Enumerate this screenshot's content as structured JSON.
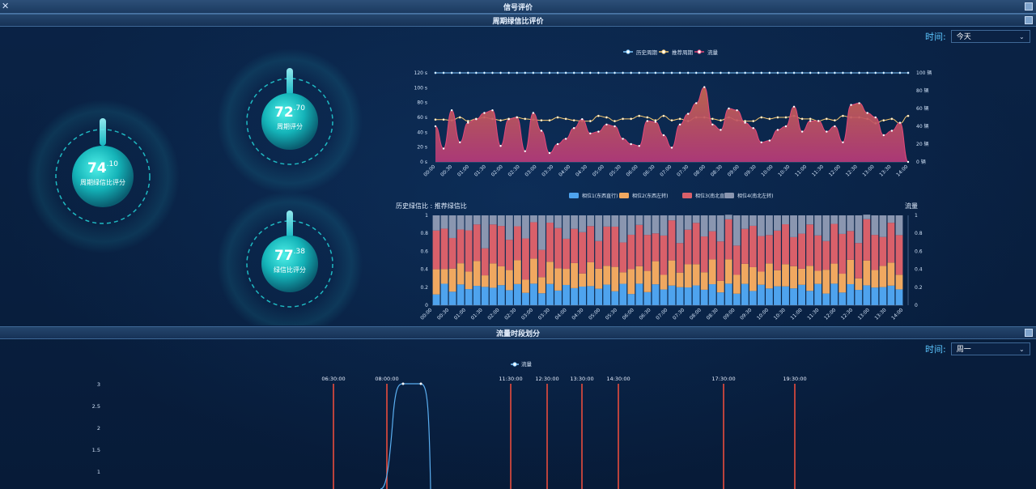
{
  "window": {
    "title": "信号评价"
  },
  "cycle_panel": {
    "title": "周期绿信比评价"
  },
  "flow_panel": {
    "title": "流量时段划分"
  },
  "time_filter_top": {
    "label": "时间:",
    "value": "今天"
  },
  "time_filter_bottom": {
    "label": "时间:",
    "value": "周一"
  },
  "scores": {
    "overall": {
      "int": "74",
      "dec": ".10",
      "label": "周期绿信比评分",
      "value": 74.1
    },
    "cycle": {
      "int": "72",
      "dec": ".70",
      "label": "周期评分",
      "value": 72.7
    },
    "green": {
      "int": "77",
      "dec": ".38",
      "label": "绿信比评分",
      "value": 77.38
    }
  },
  "colors": {
    "accent": "#5cc6ff",
    "history_cycle": "#7ec8ff",
    "recommend_cycle": "#f6c86e",
    "flow": "#e2497a",
    "phase1": "#4ea3ee",
    "phase2": "#f0a860",
    "phase3": "#d9606a",
    "phase4": "#8a96b0",
    "marker": "#e84c3d"
  },
  "chart_data": [
    {
      "type": "line",
      "legend": [
        "历史周期",
        "推荐周期",
        "流量"
      ],
      "y_left_ticks": [
        "0 s",
        "20 s",
        "40 s",
        "60 s",
        "80 s",
        "100 s",
        "120 s"
      ],
      "y_right_ticks": [
        "0 辆",
        "20 辆",
        "40 辆",
        "60 辆",
        "80 辆",
        "100 辆"
      ],
      "y_left_range": [
        0,
        120
      ],
      "y_right_range": [
        0,
        100
      ],
      "x_labels": [
        "00:00",
        "00:30",
        "01:00",
        "01:30",
        "02:00",
        "02:30",
        "03:00",
        "03:30",
        "04:00",
        "04:30",
        "05:00",
        "05:30",
        "06:00",
        "06:30",
        "07:00",
        "07:30",
        "08:00",
        "08:30",
        "09:00",
        "09:30",
        "10:00",
        "10:30",
        "11:00",
        "11:30",
        "12:00",
        "12:30",
        "13:00",
        "13:30",
        "14:00"
      ],
      "series": [
        {
          "name": "历史周期",
          "axis": "left",
          "values": [
            120,
            120,
            120,
            120,
            120,
            120,
            120,
            120,
            120,
            120,
            120,
            120,
            120,
            120,
            120,
            120,
            120,
            120,
            120,
            120,
            120,
            120,
            120,
            120,
            120,
            120,
            120,
            120,
            120,
            120,
            120,
            120,
            120,
            120,
            120,
            120,
            120,
            120,
            120,
            120,
            120,
            120,
            120,
            120,
            120,
            120,
            120,
            120,
            120,
            120,
            120,
            120,
            120,
            120,
            120,
            120,
            120,
            120,
            120
          ]
        },
        {
          "name": "推荐周期",
          "axis": "left",
          "values": [
            57,
            57,
            56,
            60,
            55,
            58,
            60,
            58,
            56,
            58,
            60,
            58,
            57,
            56,
            56,
            60,
            58,
            56,
            55,
            55,
            62,
            60,
            55,
            58,
            58,
            62,
            60,
            56,
            62,
            56,
            58,
            55,
            60,
            60,
            58,
            56,
            60,
            56,
            55,
            55,
            60,
            58,
            60,
            60,
            62,
            58,
            58,
            55,
            58,
            56,
            62,
            60,
            60,
            58,
            52,
            56,
            58,
            52,
            62
          ]
        },
        {
          "name": "流量",
          "axis": "right",
          "values": [
            40,
            15,
            58,
            22,
            44,
            48,
            55,
            58,
            18,
            48,
            50,
            12,
            55,
            35,
            10,
            20,
            26,
            38,
            48,
            32,
            34,
            42,
            40,
            26,
            20,
            18,
            46,
            45,
            30,
            16,
            42,
            54,
            66,
            84,
            42,
            36,
            60,
            58,
            44,
            38,
            22,
            24,
            36,
            40,
            62,
            34,
            46,
            46,
            34,
            40,
            22,
            64,
            66,
            55,
            50,
            30,
            35,
            44,
            0
          ]
        }
      ]
    },
    {
      "type": "bar",
      "stacked": true,
      "left_title": "历史绿信比 : 推荐绿信比",
      "right_title": "流量",
      "legend": [
        "相位1(东西直行)",
        "相位2(东西左转)",
        "相位3(南北直行)",
        "相位4(南北左转)"
      ],
      "y_ticks": [
        "0",
        "0.2",
        "0.4",
        "0.6",
        "0.8",
        "1"
      ],
      "ylim": [
        0,
        1
      ],
      "x_labels": [
        "00:00",
        "00:30",
        "01:00",
        "01:30",
        "02:00",
        "02:30",
        "03:00",
        "03:30",
        "04:00",
        "04:30",
        "05:00",
        "05:30",
        "06:00",
        "06:30",
        "07:00",
        "07:30",
        "08:00",
        "08:30",
        "09:00",
        "09:30",
        "10:00",
        "10:30",
        "11:00",
        "11:30",
        "12:00",
        "12:30",
        "13:00",
        "13:30",
        "14:00"
      ]
    },
    {
      "type": "line",
      "legend": [
        "流量"
      ],
      "y_ticks": [
        "1",
        "1.5",
        "2",
        "2.5",
        "3"
      ],
      "markers": [
        "06:30:00",
        "08:00:00",
        "11:30:00",
        "12:30:00",
        "13:30:00",
        "14:30:00",
        "17:30:00",
        "19:30:00"
      ]
    }
  ]
}
